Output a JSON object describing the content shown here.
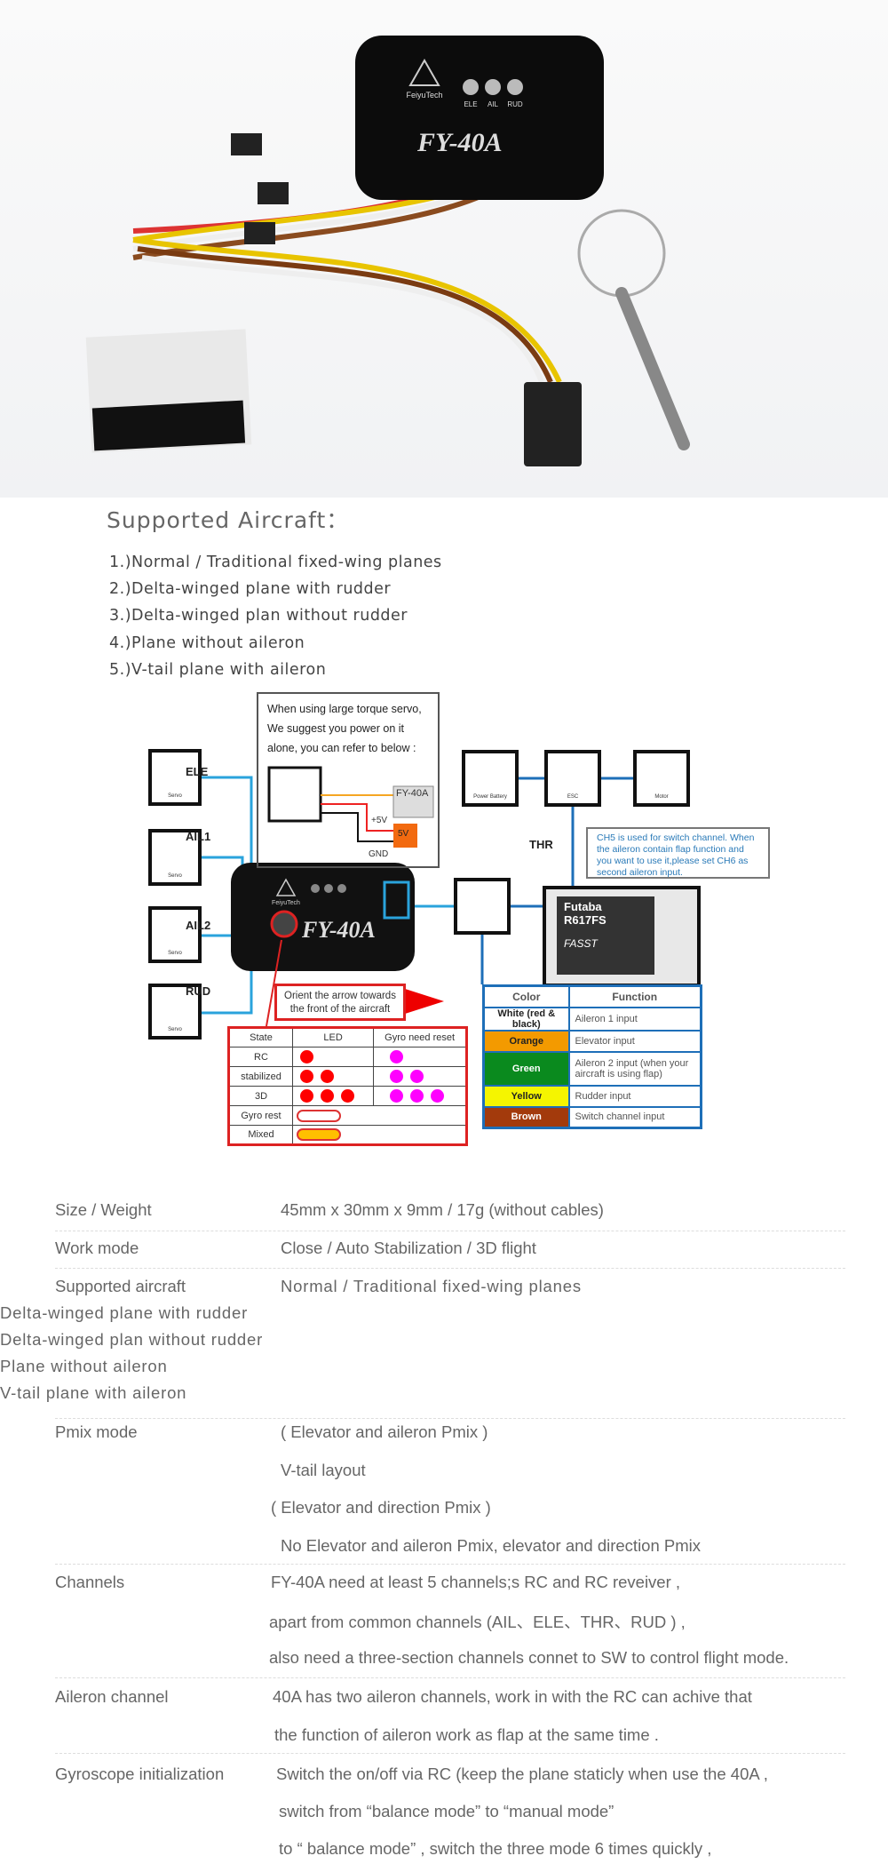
{
  "product": {
    "model": "FY-40A",
    "brand": "FeiyuTech",
    "led_labels": [
      "ELE",
      "AIL",
      "RUD"
    ]
  },
  "supported": {
    "title": "Supported Aircraft：",
    "items": [
      "1.)Normal / Traditional fixed-wing planes",
      "2.)Delta-winged plane with rudder",
      "3.)Delta-winged plan without rudder",
      "4.)Plane without aileron",
      "5.)V-tail plane with aileron"
    ]
  },
  "diagram": {
    "servo_caption": "Servo",
    "channels": [
      "ELE",
      "AIL1",
      "AIL2",
      "RUD"
    ],
    "thr": "THR",
    "power_note": [
      "When using large torque servo,",
      "We suggest you power on it",
      "alone, you can refer to below :"
    ],
    "power_labels": {
      "fc": "FY-40A",
      "plus5v": "+5V",
      "bec": "5V",
      "gnd": "GND"
    },
    "battery": "Power Battery",
    "esc": "ESC",
    "motor": "Motor",
    "ch5_note": "CH5 is used for switch channel. When the aileron contain flap function and you want to use it,please set CH6 as second aileron input.",
    "receiver": {
      "brand": "Futaba",
      "model": "R617FS",
      "tech": "FASST"
    },
    "orient_note": "Orient the arrow towards the front of the aircraft",
    "color_table": {
      "headers": [
        "Color",
        "Function"
      ],
      "rows": [
        {
          "color": "White (red & black)",
          "function": "Aileron 1 input",
          "bg": "#ffffff",
          "fg": "#222222"
        },
        {
          "color": "Orange",
          "function": "Elevator input",
          "bg": "#f39a00",
          "fg": "#222222"
        },
        {
          "color": "Green",
          "function": "Aileron 2 input (when your aircraft is using flap)",
          "bg": "#0a8a1e",
          "fg": "#ffffff"
        },
        {
          "color": "Yellow",
          "function": "Rudder input",
          "bg": "#f5f500",
          "fg": "#222222"
        },
        {
          "color": "Brown",
          "function": "Switch channel input",
          "bg": "#a33a0c",
          "fg": "#ffffff"
        }
      ]
    },
    "led_table": {
      "headers": [
        "State",
        "LED",
        "Gyro need reset"
      ],
      "rows": [
        {
          "state": "RC",
          "led": 1,
          "reset": 1
        },
        {
          "state": "stabilized",
          "led": 2,
          "reset": 2
        },
        {
          "state": "3D",
          "led": 3,
          "reset": 3
        },
        {
          "state": "Gyro rest",
          "led": "white-bar"
        },
        {
          "state": "Mixed",
          "led": "orange-bar"
        }
      ]
    }
  },
  "specs": [
    {
      "label": "Size / Weight",
      "lines": [
        "45mm x 30mm x 9mm / 17g (without cables)"
      ]
    },
    {
      "label": "Work mode",
      "lines": [
        "Close / Auto Stabilization / 3D flight"
      ]
    },
    {
      "label": "Supported aircraft",
      "lines": [
        "Normal / Traditional fixed-wing planes",
        "Delta-winged plane with rudder",
        "Delta-winged plan without rudder",
        "Plane without aileron",
        "V-tail plane with aileron"
      ]
    },
    {
      "label": "Pmix mode",
      "lines": [
        "( Elevator and aileron Pmix )",
        "V-tail layout",
        "( Elevator  and direction Pmix )",
        "No Elevator and aileron Pmix, elevator  and direction Pmix"
      ]
    },
    {
      "label": "Channels",
      "lines": [
        "FY-40A need at least 5 channels;s RC and RC reveiver ,",
        "apart from common channels (AIL、ELE、THR、RUD ) ,",
        "also need a three-section channels connet to SW to control flight mode."
      ]
    },
    {
      "label": "Aileron channel",
      "lines": [
        "40A has two aileron channels, work in with the RC can achive that",
        "the function of aileron work as flap at the same time ."
      ]
    },
    {
      "label": "Gyroscope initialization",
      "lines": [
        "Switch the on/off via RC (keep the plane staticly when use the 40A ,",
        "switch from “balance mode”  to “manual mode”",
        "to “ balance mode” , switch the three mode 6 times quickly ,"
      ]
    }
  ]
}
